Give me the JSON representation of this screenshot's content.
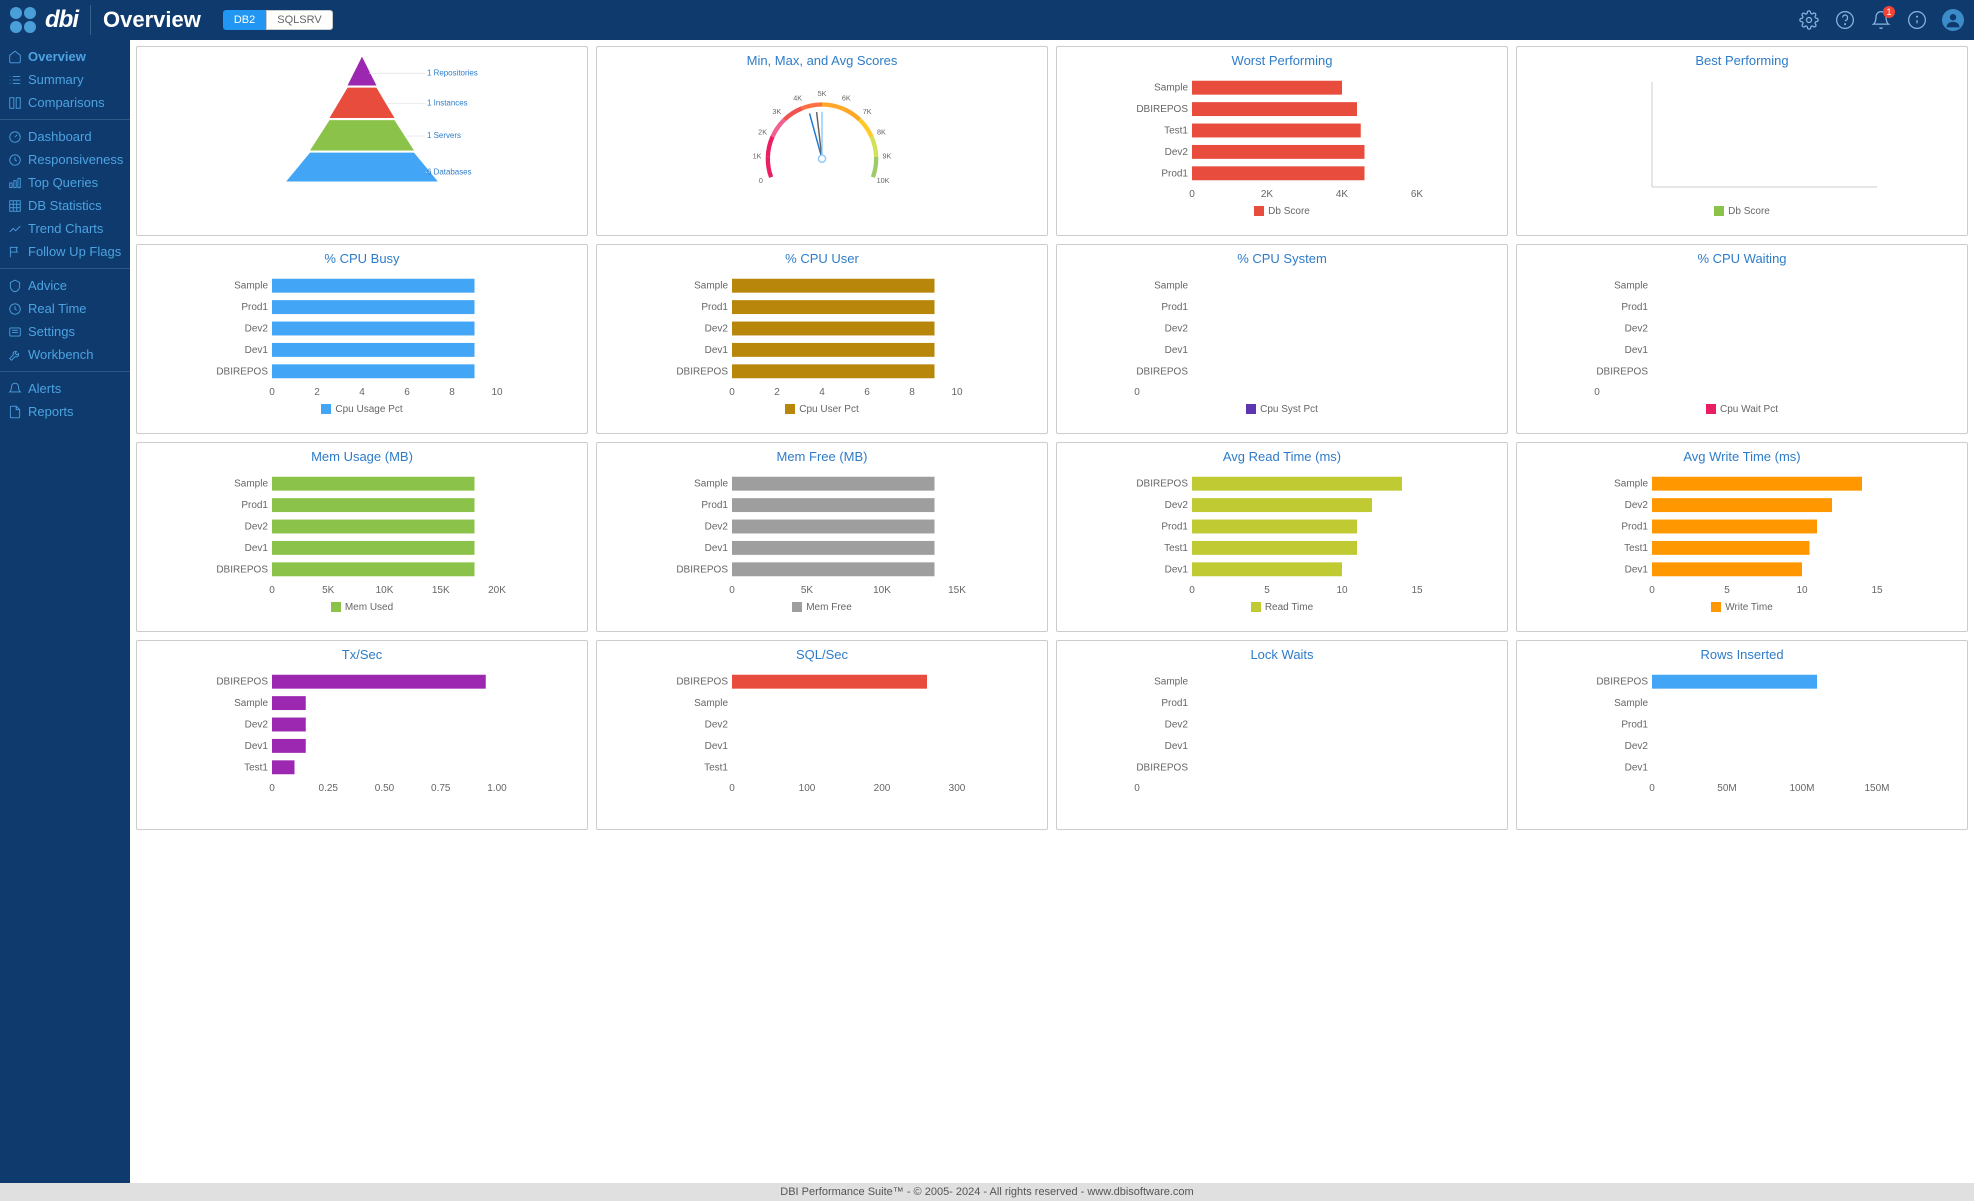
{
  "header": {
    "logo_text": "dbi",
    "page_title": "Overview",
    "db_tabs": [
      {
        "label": "DB2",
        "active": true
      },
      {
        "label": "SQLSRV",
        "active": false
      }
    ],
    "bell_badge": "1"
  },
  "sidebar": {
    "groups": [
      [
        {
          "label": "Overview",
          "icon": "home",
          "active": true
        },
        {
          "label": "Summary",
          "icon": "list",
          "active": false
        },
        {
          "label": "Comparisons",
          "icon": "compare",
          "active": false
        }
      ],
      [
        {
          "label": "Dashboard",
          "icon": "gauge",
          "active": false
        },
        {
          "label": "Responsiveness",
          "icon": "clock",
          "active": false
        },
        {
          "label": "Top Queries",
          "icon": "bars",
          "active": false
        },
        {
          "label": "DB Statistics",
          "icon": "table",
          "active": false
        },
        {
          "label": "Trend Charts",
          "icon": "trend",
          "active": false
        },
        {
          "label": "Follow Up Flags",
          "icon": "flag",
          "active": false
        }
      ],
      [
        {
          "label": "Advice",
          "icon": "shield",
          "active": false
        },
        {
          "label": "Real Time",
          "icon": "clock2",
          "active": false
        },
        {
          "label": "Settings",
          "icon": "settings",
          "active": false
        },
        {
          "label": "Workbench",
          "icon": "wrench",
          "active": false
        }
      ],
      [
        {
          "label": "Alerts",
          "icon": "bell",
          "active": false
        },
        {
          "label": "Reports",
          "icon": "doc",
          "active": false
        }
      ]
    ]
  },
  "pyramid": {
    "labels": [
      "1 Repositories",
      "1 Instances",
      "1 Servers",
      "6 Databases"
    ],
    "colors": [
      "#9c27b0",
      "#e74c3c",
      "#8bc34a",
      "#42a5f5"
    ]
  },
  "gauge": {
    "title": "Min, Max, and Avg Scores",
    "ticks": [
      "0",
      "1K",
      "2K",
      "3K",
      "4K",
      "5K",
      "6K",
      "7K",
      "8K",
      "9K",
      "10K"
    ],
    "min_val": 4300,
    "avg_val": 4700,
    "max_val": 5000,
    "range": 10000
  },
  "chart_data": [
    {
      "id": "worst",
      "title": "Worst Performing",
      "type": "bar",
      "color": "#e74c3c",
      "legend": "Db Score",
      "categories": [
        "Sample",
        "DBIREPOS",
        "Test1",
        "Dev2",
        "Prod1"
      ],
      "values": [
        4000,
        4400,
        4500,
        4600,
        4600
      ],
      "xticks": [
        0,
        2000,
        4000,
        6000
      ],
      "xtick_labels": [
        "0",
        "2K",
        "4K",
        "6K"
      ]
    },
    {
      "id": "best",
      "title": "Best Performing",
      "type": "bar",
      "color": "#8bc34a",
      "legend": "Db Score",
      "categories": [],
      "values": [],
      "xticks": [],
      "xtick_labels": []
    },
    {
      "id": "cpubusy",
      "title": "% CPU Busy",
      "type": "bar",
      "color": "#42a5f5",
      "legend": "Cpu Usage Pct",
      "categories": [
        "Sample",
        "Prod1",
        "Dev2",
        "Dev1",
        "DBIREPOS"
      ],
      "values": [
        9,
        9,
        9,
        9,
        9
      ],
      "xticks": [
        0,
        2,
        4,
        6,
        8,
        10
      ],
      "xtick_labels": [
        "0",
        "2",
        "4",
        "6",
        "8",
        "10"
      ]
    },
    {
      "id": "cpuuser",
      "title": "% CPU User",
      "type": "bar",
      "color": "#b8860b",
      "legend": "Cpu User Pct",
      "categories": [
        "Sample",
        "Prod1",
        "Dev2",
        "Dev1",
        "DBIREPOS"
      ],
      "values": [
        9,
        9,
        9,
        9,
        9
      ],
      "xticks": [
        0,
        2,
        4,
        6,
        8,
        10
      ],
      "xtick_labels": [
        "0",
        "2",
        "4",
        "6",
        "8",
        "10"
      ]
    },
    {
      "id": "cpusys",
      "title": "% CPU System",
      "type": "bar",
      "color": "#5e35b1",
      "legend": "Cpu Syst Pct",
      "categories": [
        "Sample",
        "Prod1",
        "Dev2",
        "Dev1",
        "DBIREPOS"
      ],
      "values": [
        0,
        0,
        0,
        0,
        0
      ],
      "xticks": [
        0
      ],
      "xtick_labels": [
        "0"
      ]
    },
    {
      "id": "cpuwait",
      "title": "% CPU Waiting",
      "type": "bar",
      "color": "#e91e63",
      "legend": "Cpu Wait Pct",
      "categories": [
        "Sample",
        "Prod1",
        "Dev2",
        "Dev1",
        "DBIREPOS"
      ],
      "values": [
        0,
        0,
        0,
        0,
        0
      ],
      "xticks": [
        0
      ],
      "xtick_labels": [
        "0"
      ]
    },
    {
      "id": "memuse",
      "title": "Mem Usage (MB)",
      "type": "bar",
      "color": "#8bc34a",
      "legend": "Mem Used",
      "categories": [
        "Sample",
        "Prod1",
        "Dev2",
        "Dev1",
        "DBIREPOS"
      ],
      "values": [
        18000,
        18000,
        18000,
        18000,
        18000
      ],
      "xticks": [
        0,
        5000,
        10000,
        15000,
        20000
      ],
      "xtick_labels": [
        "0",
        "5K",
        "10K",
        "15K",
        "20K"
      ]
    },
    {
      "id": "memfree",
      "title": "Mem Free (MB)",
      "type": "bar",
      "color": "#9e9e9e",
      "legend": "Mem Free",
      "categories": [
        "Sample",
        "Prod1",
        "Dev2",
        "Dev1",
        "DBIREPOS"
      ],
      "values": [
        13500,
        13500,
        13500,
        13500,
        13500
      ],
      "xticks": [
        0,
        5000,
        10000,
        15000
      ],
      "xtick_labels": [
        "0",
        "5K",
        "10K",
        "15K"
      ]
    },
    {
      "id": "readtime",
      "title": "Avg Read Time (ms)",
      "type": "bar",
      "color": "#c0ca33",
      "legend": "Read Time",
      "categories": [
        "DBIREPOS",
        "Dev2",
        "Prod1",
        "Test1",
        "Dev1"
      ],
      "values": [
        14,
        12,
        11,
        11,
        10
      ],
      "xticks": [
        0,
        5,
        10,
        15
      ],
      "xtick_labels": [
        "0",
        "5",
        "10",
        "15"
      ]
    },
    {
      "id": "writetime",
      "title": "Avg Write Time (ms)",
      "type": "bar",
      "color": "#ff9800",
      "legend": "Write Time",
      "categories": [
        "Sample",
        "Dev2",
        "Prod1",
        "Test1",
        "Dev1"
      ],
      "values": [
        14,
        12,
        11,
        10.5,
        10
      ],
      "xticks": [
        0,
        5,
        10,
        15
      ],
      "xtick_labels": [
        "0",
        "5",
        "10",
        "15"
      ]
    },
    {
      "id": "txsec",
      "title": "Tx/Sec",
      "type": "bar",
      "color": "#9c27b0",
      "legend": "",
      "categories": [
        "DBIREPOS",
        "Sample",
        "Dev2",
        "Dev1",
        "Test1"
      ],
      "values": [
        0.95,
        0.15,
        0.15,
        0.15,
        0.1
      ],
      "xticks": [
        0,
        0.25,
        0.5,
        0.75,
        1.0
      ],
      "xtick_labels": [
        "0",
        "0.25",
        "0.50",
        "0.75",
        "1.00"
      ]
    },
    {
      "id": "sqlsec",
      "title": "SQL/Sec",
      "type": "bar",
      "color": "#e74c3c",
      "legend": "",
      "categories": [
        "DBIREPOS",
        "Sample",
        "Dev2",
        "Dev1",
        "Test1"
      ],
      "values": [
        260,
        0,
        0,
        0,
        0
      ],
      "xticks": [
        0,
        100,
        200,
        300
      ],
      "xtick_labels": [
        "0",
        "100",
        "200",
        "300"
      ]
    },
    {
      "id": "lockwaits",
      "title": "Lock Waits",
      "type": "bar",
      "color": "#9e9e9e",
      "legend": "",
      "categories": [
        "Sample",
        "Prod1",
        "Dev2",
        "Dev1",
        "DBIREPOS"
      ],
      "values": [
        0,
        0,
        0,
        0,
        0
      ],
      "xticks": [
        0
      ],
      "xtick_labels": [
        "0"
      ]
    },
    {
      "id": "rows",
      "title": "Rows Inserted",
      "type": "bar",
      "color": "#42a5f5",
      "legend": "",
      "categories": [
        "DBIREPOS",
        "Sample",
        "Prod1",
        "Dev2",
        "Dev1"
      ],
      "values": [
        110000000,
        0,
        0,
        0,
        0
      ],
      "xticks": [
        0,
        50000000,
        100000000,
        150000000
      ],
      "xtick_labels": [
        "0",
        "50M",
        "100M",
        "150M"
      ]
    }
  ],
  "footer": "DBI Performance Suite™ - © 2005- 2024 - All rights reserved - www.dbisoftware.com"
}
